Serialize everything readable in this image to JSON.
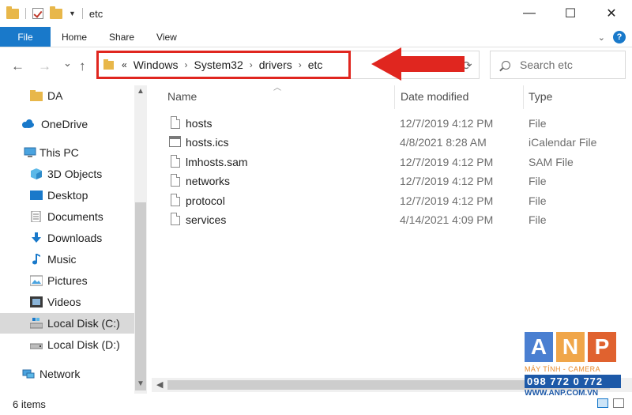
{
  "window": {
    "title": "etc",
    "controls": {
      "minimize": "—",
      "maximize": "☐",
      "close": "✕"
    }
  },
  "ribbon": {
    "tabs": [
      "File",
      "Home",
      "Share",
      "View"
    ],
    "help": "?"
  },
  "nav": {
    "back": "←",
    "forward": "→",
    "recent": "⌄",
    "up": "↑"
  },
  "address": {
    "overflow": "«",
    "separator": "›",
    "crumbs": [
      "Windows",
      "System32",
      "drivers",
      "etc"
    ]
  },
  "search": {
    "placeholder": "Search etc"
  },
  "sidebar": {
    "items": [
      {
        "label": "DA",
        "icon": "folder-icon"
      },
      {
        "label": "OneDrive",
        "icon": "cloud-icon"
      },
      {
        "label": "This PC",
        "icon": "computer-icon"
      },
      {
        "label": "3D Objects",
        "icon": "cube-icon"
      },
      {
        "label": "Desktop",
        "icon": "desktop-icon"
      },
      {
        "label": "Documents",
        "icon": "documents-icon"
      },
      {
        "label": "Downloads",
        "icon": "download-icon"
      },
      {
        "label": "Music",
        "icon": "music-icon"
      },
      {
        "label": "Pictures",
        "icon": "pictures-icon"
      },
      {
        "label": "Videos",
        "icon": "videos-icon"
      },
      {
        "label": "Local Disk (C:)",
        "icon": "drive-c-icon",
        "selected": true
      },
      {
        "label": "Local Disk (D:)",
        "icon": "drive-d-icon"
      },
      {
        "label": "Network",
        "icon": "network-icon"
      }
    ]
  },
  "filelist": {
    "columns": {
      "name": "Name",
      "date": "Date modified",
      "type": "Type"
    },
    "files": [
      {
        "name": "hosts",
        "date": "12/7/2019 4:12 PM",
        "type": "File",
        "icon": "file-icon"
      },
      {
        "name": "hosts.ics",
        "date": "4/8/2021 8:28 AM",
        "type": "iCalendar File",
        "icon": "calendar-file-icon"
      },
      {
        "name": "lmhosts.sam",
        "date": "12/7/2019 4:12 PM",
        "type": "SAM File",
        "icon": "file-icon"
      },
      {
        "name": "networks",
        "date": "12/7/2019 4:12 PM",
        "type": "File",
        "icon": "file-icon"
      },
      {
        "name": "protocol",
        "date": "12/7/2019 4:12 PM",
        "type": "File",
        "icon": "file-icon"
      },
      {
        "name": "services",
        "date": "4/14/2021 4:09 PM",
        "type": "File",
        "icon": "file-icon"
      }
    ]
  },
  "status": {
    "item_count": "6 items"
  },
  "watermark": {
    "letters": [
      "A",
      "N",
      "P"
    ],
    "tagline": "MÁY TÍNH - CAMERA",
    "phone": "098 772 0 772",
    "site": "WWW.ANP.COM.VN"
  },
  "colors": {
    "accent": "#1979ca",
    "highlight": "#e0261f",
    "selected": "#d9d9d9",
    "folder": "#e8b74a"
  }
}
